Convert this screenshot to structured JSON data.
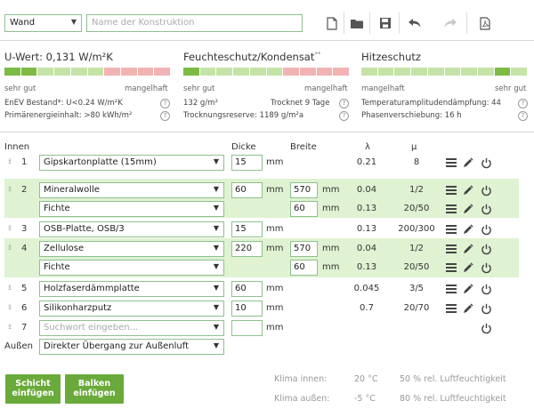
{
  "toolbar": {
    "type_value": "Wand",
    "name_placeholder": "Name der Konstruktion"
  },
  "sections": {
    "uwert": {
      "title": "U-Wert: 0,131 W/m²K",
      "left_label": "sehr gut",
      "right_label": "mangelhaft",
      "line1": "EnEV Bestand*: U<0.24 W/m²K",
      "line2": "Primärenergieinhalt: >80 kWh/m²",
      "help": "?"
    },
    "feuchte": {
      "title": "Feuchteschutz/Kondensat",
      "title_sup": "**",
      "left_label": "sehr gut",
      "right_label": "mangelhaft",
      "line1_left": "132 g/m²",
      "line1_right": "Trocknet 9 Tage",
      "line2": "Trocknungsreserve: 1189 g/m²a",
      "help": "?"
    },
    "hitze": {
      "title": "Hitzeschutz",
      "left_label": "mangelhaft",
      "right_label": "sehr gut",
      "line1": "Temperaturamplitudendämpfung: 44",
      "line2": "Phasenverschiebung: 16 h",
      "help": "?"
    }
  },
  "table": {
    "headers": {
      "innen": "Innen",
      "dicke": "Dicke",
      "breite": "Breite",
      "lambda": "λ",
      "mu": "μ"
    },
    "rows": [
      {
        "num": "1",
        "material": "Gipskartonplatte (15mm)",
        "dicke": "15",
        "dicke_unit": "mm",
        "breite": "",
        "breite_unit": "",
        "lambda": "0.21",
        "mu": "8"
      },
      {
        "num": "2",
        "material": "Mineralwolle",
        "dicke": "60",
        "dicke_unit": "mm",
        "breite": "570",
        "breite_unit": "mm",
        "lambda": "0.04",
        "mu": "1/2"
      },
      {
        "num": "",
        "material": "Fichte",
        "dicke": "",
        "dicke_unit": "",
        "breite": "60",
        "breite_unit": "mm",
        "lambda": "0.13",
        "mu": "20/50"
      },
      {
        "num": "3",
        "material": "OSB-Platte, OSB/3",
        "dicke": "15",
        "dicke_unit": "mm",
        "breite": "",
        "breite_unit": "",
        "lambda": "0.13",
        "mu": "200/300"
      },
      {
        "num": "4",
        "material": "Zellulose",
        "dicke": "220",
        "dicke_unit": "mm",
        "breite": "570",
        "breite_unit": "mm",
        "lambda": "0.04",
        "mu": "1/2"
      },
      {
        "num": "",
        "material": "Fichte",
        "dicke": "",
        "dicke_unit": "",
        "breite": "60",
        "breite_unit": "mm",
        "lambda": "0.13",
        "mu": "20/50"
      },
      {
        "num": "5",
        "material": "Holzfaserdämmplatte",
        "dicke": "60",
        "dicke_unit": "mm",
        "breite": "",
        "breite_unit": "",
        "lambda": "0.045",
        "mu": "3/5"
      },
      {
        "num": "6",
        "material": "Silikonharzputz",
        "dicke": "10",
        "dicke_unit": "mm",
        "breite": "",
        "breite_unit": "",
        "lambda": "0.7",
        "mu": "20/70"
      },
      {
        "num": "7",
        "material": "Suchwort eingeben...",
        "dicke": "",
        "dicke_unit": "mm",
        "breite": "",
        "breite_unit": "",
        "lambda": "",
        "mu": ""
      }
    ],
    "aussen_label": "Außen",
    "aussen_value": "Direkter Übergang zur Außenluft"
  },
  "buttons": {
    "schicht_line1": "Schicht",
    "schicht_line2": "einfügen",
    "balken_line1": "Balken",
    "balken_line2": "einfügen"
  },
  "klima": {
    "innen_label": "Klima innen:",
    "innen_temp": "20 °C",
    "innen_hum": "50 % rel. Luftfeuchtigkeit",
    "aussen_label": "Klima außen:",
    "aussen_temp": "-5 °C",
    "aussen_hum": "80 % rel. Luftfeuchtigkeit"
  },
  "colors": {
    "accent": "#6aaa3a",
    "row_highlight": "#dff2d2",
    "bar_good": "#7dbb44",
    "bar_light": "#c5e3a8",
    "bar_bad": "#f2b3b3"
  }
}
